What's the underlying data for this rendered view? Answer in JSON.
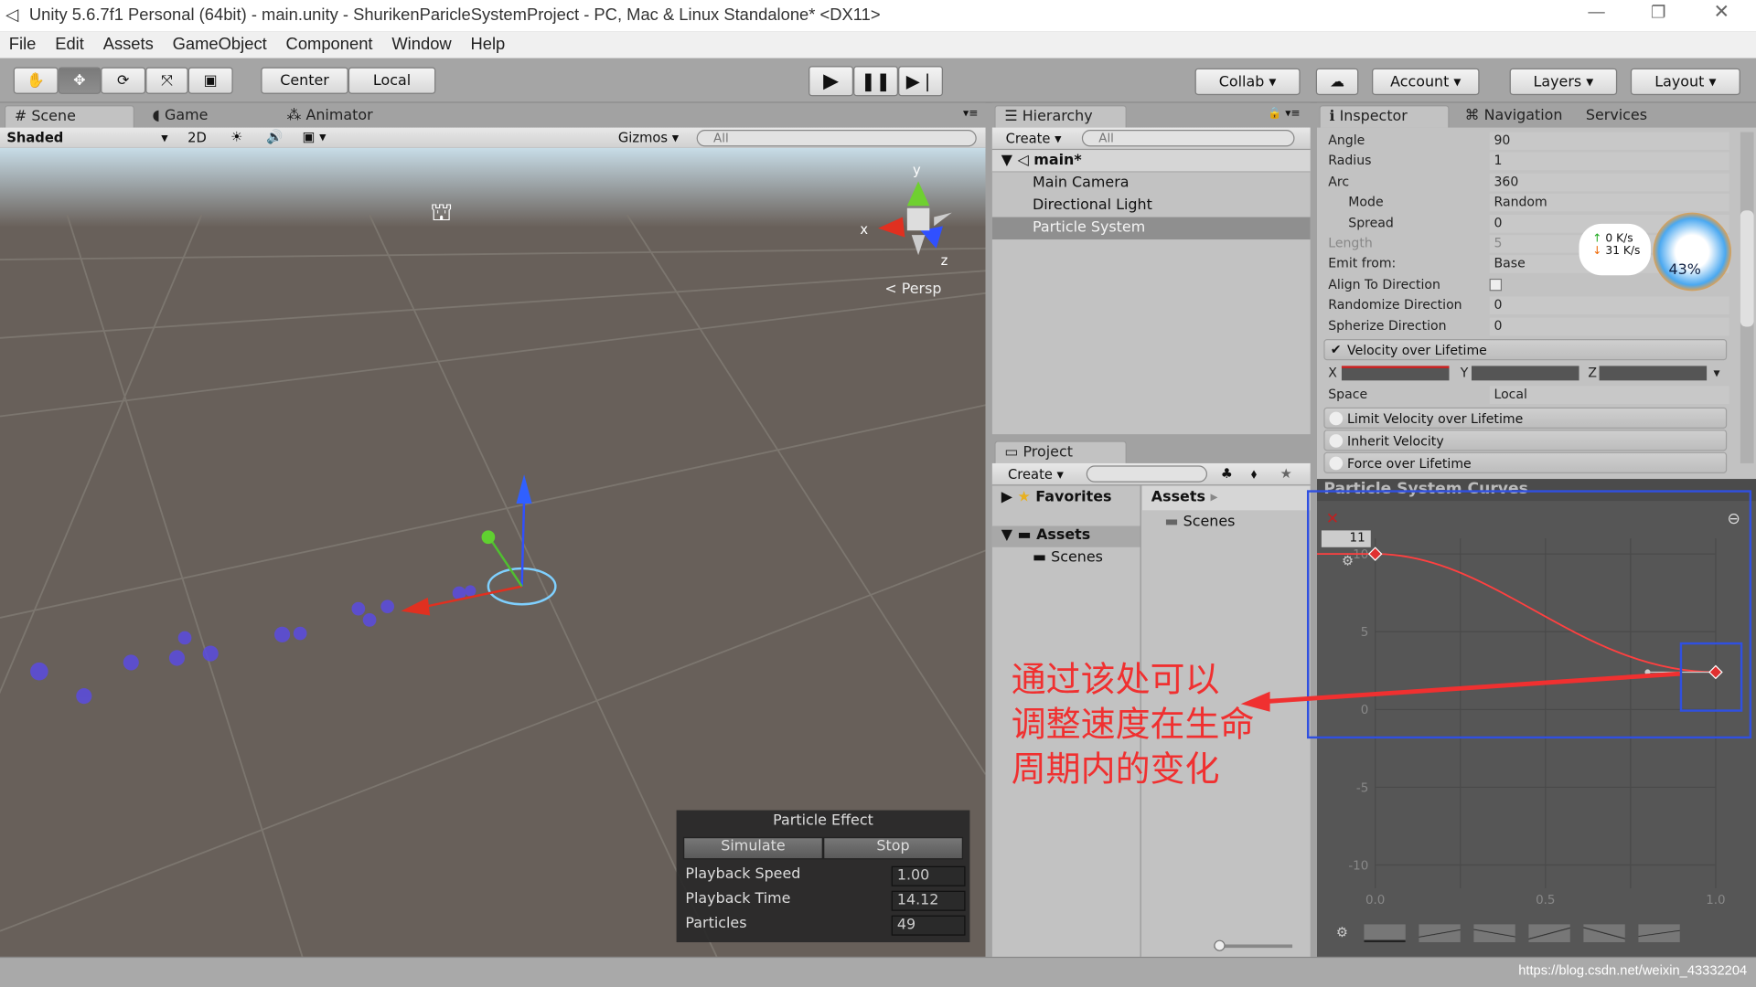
{
  "window": {
    "title": "Unity 5.6.7f1 Personal (64bit) - main.unity - ShurikenParicleSystemProject - PC, Mac & Linux Standalone* <DX11>"
  },
  "menu": [
    "File",
    "Edit",
    "Assets",
    "GameObject",
    "Component",
    "Window",
    "Help"
  ],
  "toolbar": {
    "tools": [
      "hand-icon",
      "move-icon",
      "rotate-icon",
      "scale-icon",
      "rect-icon"
    ],
    "center": "Center",
    "local": "Local",
    "collab": "Collab ▾",
    "account": "Account",
    "layers": "Layers",
    "layout": "Layout"
  },
  "scene": {
    "tabs": [
      "Scene",
      "Game",
      "Animator"
    ],
    "shading": "Shaded",
    "mode2d": "2D",
    "gizmos": "Gizmos",
    "search_placeholder": "All",
    "persp": "Persp",
    "axes": {
      "x": "x",
      "y": "y",
      "z": "z"
    }
  },
  "particle_effect": {
    "title": "Particle Effect",
    "simulate": "Simulate",
    "stop": "Stop",
    "rows": [
      {
        "label": "Playback Speed",
        "value": "1.00"
      },
      {
        "label": "Playback Time",
        "value": "14.12"
      },
      {
        "label": "Particles",
        "value": "49"
      }
    ]
  },
  "hierarchy": {
    "tab": "Hierarchy",
    "create": "Create",
    "search_placeholder": "All",
    "scene": "main*",
    "items": [
      "Main Camera",
      "Directional Light",
      "Particle System"
    ],
    "selected": "Particle System"
  },
  "project": {
    "tab": "Project",
    "create": "Create",
    "favorites": "Favorites",
    "assets": "Assets",
    "scenes": "Scenes",
    "breadcrumb": "Assets",
    "folder": "Scenes"
  },
  "inspector": {
    "tabs": [
      "Inspector",
      "Navigation",
      "Services"
    ],
    "rows": [
      {
        "label": "Angle",
        "value": "90"
      },
      {
        "label": "Radius",
        "value": "1"
      },
      {
        "label": "Arc",
        "value": "360"
      },
      {
        "label": "Mode",
        "value": "Random",
        "indent": true
      },
      {
        "label": "Spread",
        "value": "0",
        "indent": true
      },
      {
        "label": "Length",
        "value": "5",
        "disabled": true
      },
      {
        "label": "Emit from:",
        "value": "Base"
      },
      {
        "label": "Align To Direction",
        "value": ""
      },
      {
        "label": "Randomize Direction",
        "value": "0"
      },
      {
        "label": "Spherize Direction",
        "value": "0"
      }
    ],
    "velocity_module": "Velocity over Lifetime",
    "axes": [
      "X",
      "Y",
      "Z"
    ],
    "space_label": "Space",
    "space_value": "Local",
    "modules": [
      "Limit Velocity over Lifetime",
      "Inherit Velocity",
      "Force over Lifetime"
    ]
  },
  "net_widget": {
    "up": "0  K/s",
    "down": "31  K/s",
    "percent": "43%"
  },
  "curves": {
    "title": "Particle System Curves",
    "max_field": "11",
    "y_ticks": [
      "10",
      "5",
      "0",
      "-5",
      "-10"
    ],
    "x_ticks": [
      "0.0",
      "0.5",
      "1.0"
    ],
    "points": [
      {
        "t": 0,
        "v": 10
      },
      {
        "t": 1,
        "v": 2.4
      }
    ],
    "curve_color": "#ff4040"
  },
  "annotation": {
    "text": "通过该处可以\n调整速度在生命\n周期内的变化",
    "color": "#f03030"
  },
  "status": {
    "watermark": "https://blog.csdn.net/weixin_43332204"
  }
}
